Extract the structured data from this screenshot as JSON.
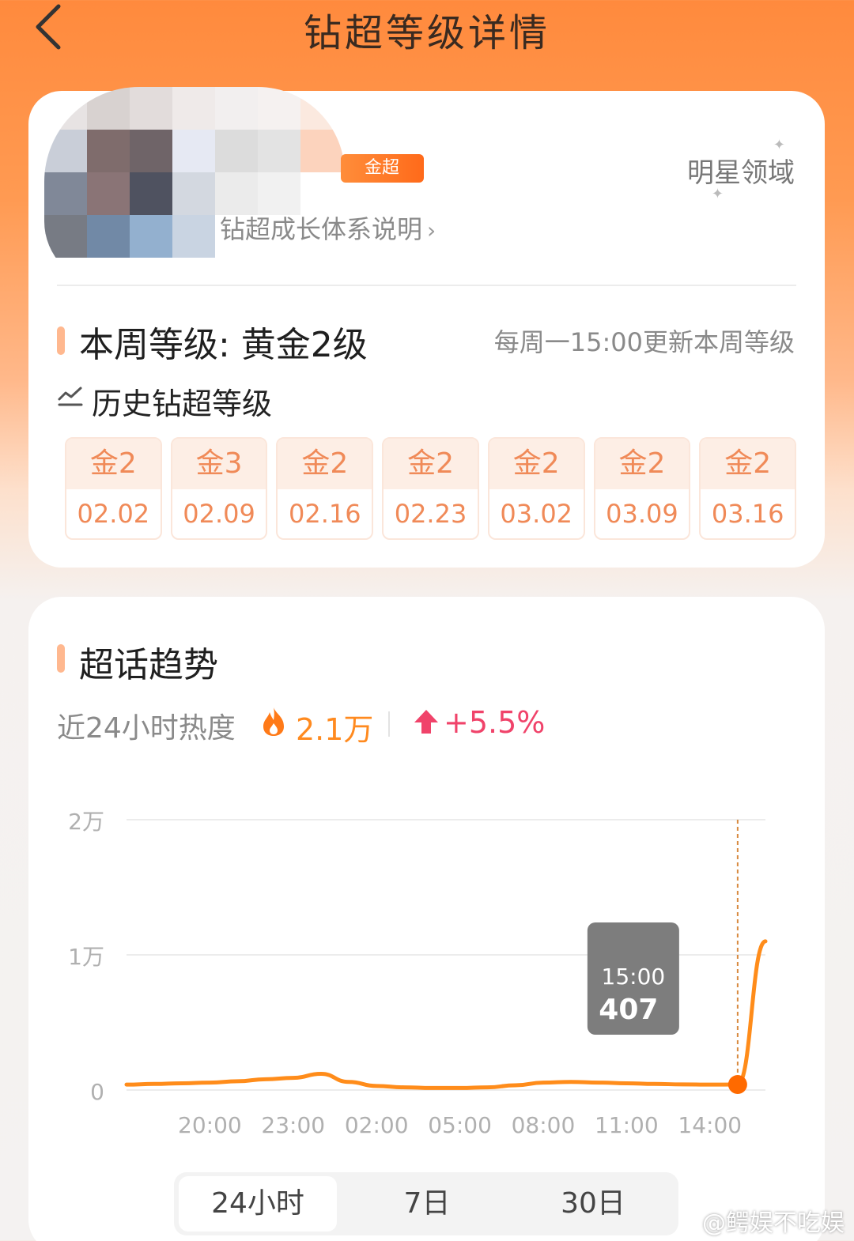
{
  "nav": {
    "title": "钻超等级详情"
  },
  "profile": {
    "badge": "金超",
    "growth_link": "钻超成长体系说明",
    "domain_link": "明星领域"
  },
  "week": {
    "level_text": "本周等级: 黄金2级",
    "update_note": "每周一15:00更新本周等级"
  },
  "history": {
    "title": "历史钻超等级",
    "items": [
      {
        "level": "金2",
        "date": "02.02"
      },
      {
        "level": "金3",
        "date": "02.09"
      },
      {
        "level": "金2",
        "date": "02.16"
      },
      {
        "level": "金2",
        "date": "02.23"
      },
      {
        "level": "金2",
        "date": "03.02"
      },
      {
        "level": "金2",
        "date": "03.09"
      },
      {
        "level": "金2",
        "date": "03.16"
      }
    ]
  },
  "trend": {
    "title": "超话趋势",
    "heat_label": "近24小时热度",
    "heat_value": "2.1万",
    "heat_change": "+5.5%"
  },
  "tabs": [
    "24小时",
    "7日",
    "30日"
  ],
  "watermark": "@鳄娱不吃娱",
  "colors": {
    "accent": "#ff8a1f",
    "up": "#f0436a",
    "line": "#ff8c1a"
  },
  "chart_data": {
    "type": "line",
    "x_tick_labels": [
      "20:00",
      "23:00",
      "02:00",
      "05:00",
      "08:00",
      "11:00",
      "14:00"
    ],
    "y_tick_labels": [
      "0",
      "1万",
      "2万"
    ],
    "ylim": [
      0,
      20000
    ],
    "series": [
      {
        "x": [
          "17:00",
          "18:00",
          "19:00",
          "20:00",
          "21:00",
          "22:00",
          "23:00",
          "00:00",
          "01:00",
          "02:00",
          "03:00",
          "04:00",
          "05:00",
          "06:00",
          "07:00",
          "08:00",
          "09:00",
          "10:00",
          "11:00",
          "12:00",
          "13:00",
          "14:00",
          "15:00",
          "16:00"
        ],
        "values": [
          400,
          450,
          500,
          550,
          650,
          800,
          900,
          1200,
          600,
          300,
          200,
          150,
          150,
          200,
          350,
          550,
          600,
          550,
          500,
          450,
          420,
          400,
          407,
          11000
        ]
      }
    ],
    "tooltip": {
      "time": "15:00",
      "value": "407"
    },
    "grid": true
  }
}
